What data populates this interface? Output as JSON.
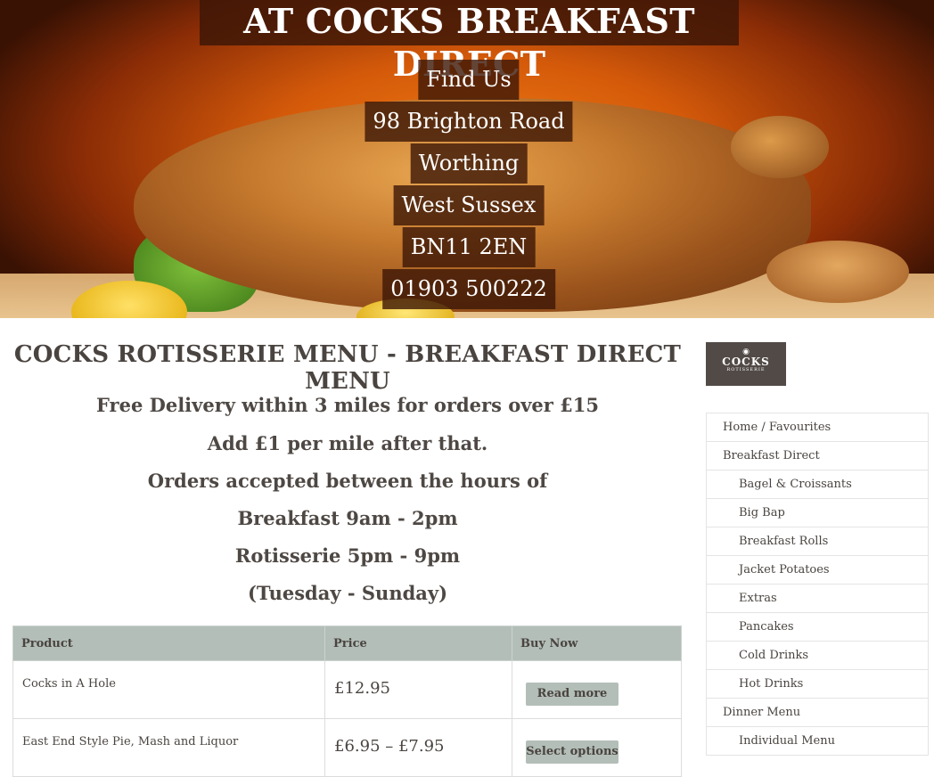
{
  "hero": {
    "title": "AT COCKS BREAKFAST DIRECT",
    "find_us": "Find Us",
    "address_line1": "98 Brighton Road",
    "address_line2": "Worthing",
    "address_line3": "West Sussex",
    "postcode": "BN11 2EN",
    "phone": "01903 500222"
  },
  "main": {
    "page_title": "COCKS ROTISSERIE MENU - BREAKFAST DIRECT MENU",
    "info_lines": [
      "Free Delivery within 3 miles for orders over £15",
      "Add £1 per mile after that.",
      "Orders accepted between the hours of",
      "Breakfast 9am - 2pm",
      "Rotisserie 5pm - 9pm",
      "(Tuesday - Sunday)"
    ],
    "table": {
      "headers": [
        "Product",
        "Price",
        "Buy Now"
      ],
      "rows": [
        {
          "product": "Cocks in A Hole",
          "price": "£12.95",
          "action": "Read more"
        },
        {
          "product": "East End Style Pie, Mash and Liquor",
          "price": "£6.95 – £7.95",
          "action": "Select options"
        }
      ]
    }
  },
  "sidebar": {
    "logo": {
      "name": "COCKS",
      "sub": "ROTISSERIE"
    },
    "nav": [
      {
        "label": "Home / Favourites",
        "level": 0
      },
      {
        "label": "Breakfast Direct",
        "level": 0
      },
      {
        "label": "Bagel & Croissants",
        "level": 1
      },
      {
        "label": "Big Bap",
        "level": 1
      },
      {
        "label": "Breakfast Rolls",
        "level": 1
      },
      {
        "label": "Jacket Potatoes",
        "level": 1
      },
      {
        "label": "Extras",
        "level": 1
      },
      {
        "label": "Pancakes",
        "level": 1
      },
      {
        "label": "Cold Drinks",
        "level": 1
      },
      {
        "label": "Hot Drinks",
        "level": 1
      },
      {
        "label": "Dinner Menu",
        "level": 0
      },
      {
        "label": "Individual Menu",
        "level": 1
      }
    ]
  }
}
